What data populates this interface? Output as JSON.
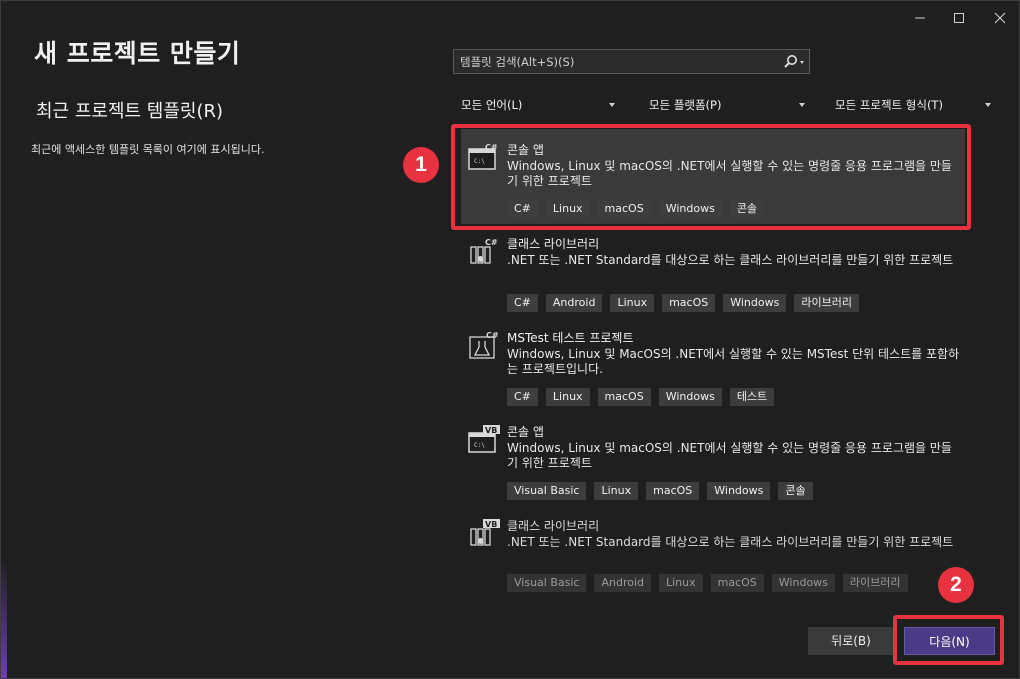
{
  "window": {
    "title": "새 프로젝트 만들기",
    "controls": [
      "minimize-icon",
      "maximize-icon",
      "close-icon"
    ],
    "accent": "#4b3a86",
    "highlight": "#e8323f"
  },
  "left": {
    "recent_heading": "최근 프로젝트 템플릿(R)",
    "recent_desc": "최근에 액세스한 템플릿 목록이 여기에 표시됩니다."
  },
  "search": {
    "placeholder": "템플릿 검색(Alt+S)(S)"
  },
  "filters": {
    "language": "모든 언어(L)",
    "platform": "모든 플랫폼(P)",
    "project_type": "모든 프로젝트 형식(T)"
  },
  "templates": [
    {
      "name": "콘솔 앱",
      "lang_badge": "C#",
      "desc": "Windows, Linux 및 macOS의 .NET에서 실행할 수 있는 명령줄 응용 프로그램을 만들기 위한 프로젝트",
      "tags": [
        "C#",
        "Linux",
        "macOS",
        "Windows",
        "콘솔"
      ]
    },
    {
      "name": "클래스 라이브러리",
      "lang_badge": "C#",
      "desc": ".NET 또는 .NET Standard를 대상으로 하는 클래스 라이브러리를 만들기 위한 프로젝트",
      "tags": [
        "C#",
        "Android",
        "Linux",
        "macOS",
        "Windows",
        "라이브러리"
      ]
    },
    {
      "name": "MSTest 테스트 프로젝트",
      "lang_badge": "C#",
      "desc": "Windows, Linux 및 MacOS의 .NET에서 실행할 수 있는 MSTest 단위 테스트를 포함하는 프로젝트입니다.",
      "tags": [
        "C#",
        "Linux",
        "macOS",
        "Windows",
        "테스트"
      ]
    },
    {
      "name": "콘솔 앱",
      "lang_badge": "VB",
      "desc": "Windows, Linux 및 macOS의 .NET에서 실행할 수 있는 명령줄 응용 프로그램을 만들기 위한 프로젝트",
      "tags": [
        "Visual Basic",
        "Linux",
        "macOS",
        "Windows",
        "콘솔"
      ]
    },
    {
      "name": "클래스 라이브러리",
      "lang_badge": "VB",
      "desc": ".NET 또는 .NET Standard를 대상으로 하는 클래스 라이브러리를 만들기 위한 프로젝트",
      "tags": [
        "Visual Basic",
        "Android",
        "Linux",
        "macOS",
        "Windows",
        "라이브러리"
      ]
    }
  ],
  "annotations": {
    "step1": "1",
    "step2": "2"
  },
  "buttons": {
    "back": "뒤로(B)",
    "next": "다음(N)"
  }
}
